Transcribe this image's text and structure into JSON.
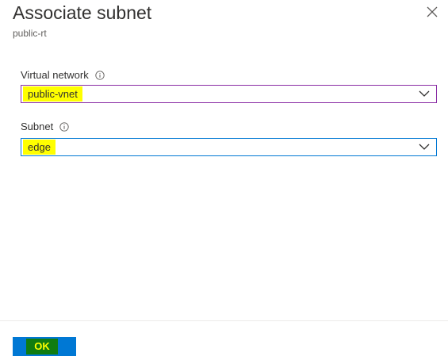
{
  "header": {
    "title": "Associate subnet",
    "subtitle": "public-rt",
    "close_icon": "close-icon"
  },
  "form": {
    "virtual_network": {
      "label": "Virtual network",
      "value": "public-vnet",
      "info_icon": "info-icon"
    },
    "subnet": {
      "label": "Subnet",
      "value": "edge",
      "info_icon": "info-icon"
    }
  },
  "footer": {
    "ok_label": "OK"
  },
  "colors": {
    "highlight": "#ffff00",
    "primary_button": "#0078d4",
    "ok_highlight": "#107c10",
    "vnet_border": "#8a2da5",
    "subnet_border": "#0078d4"
  }
}
